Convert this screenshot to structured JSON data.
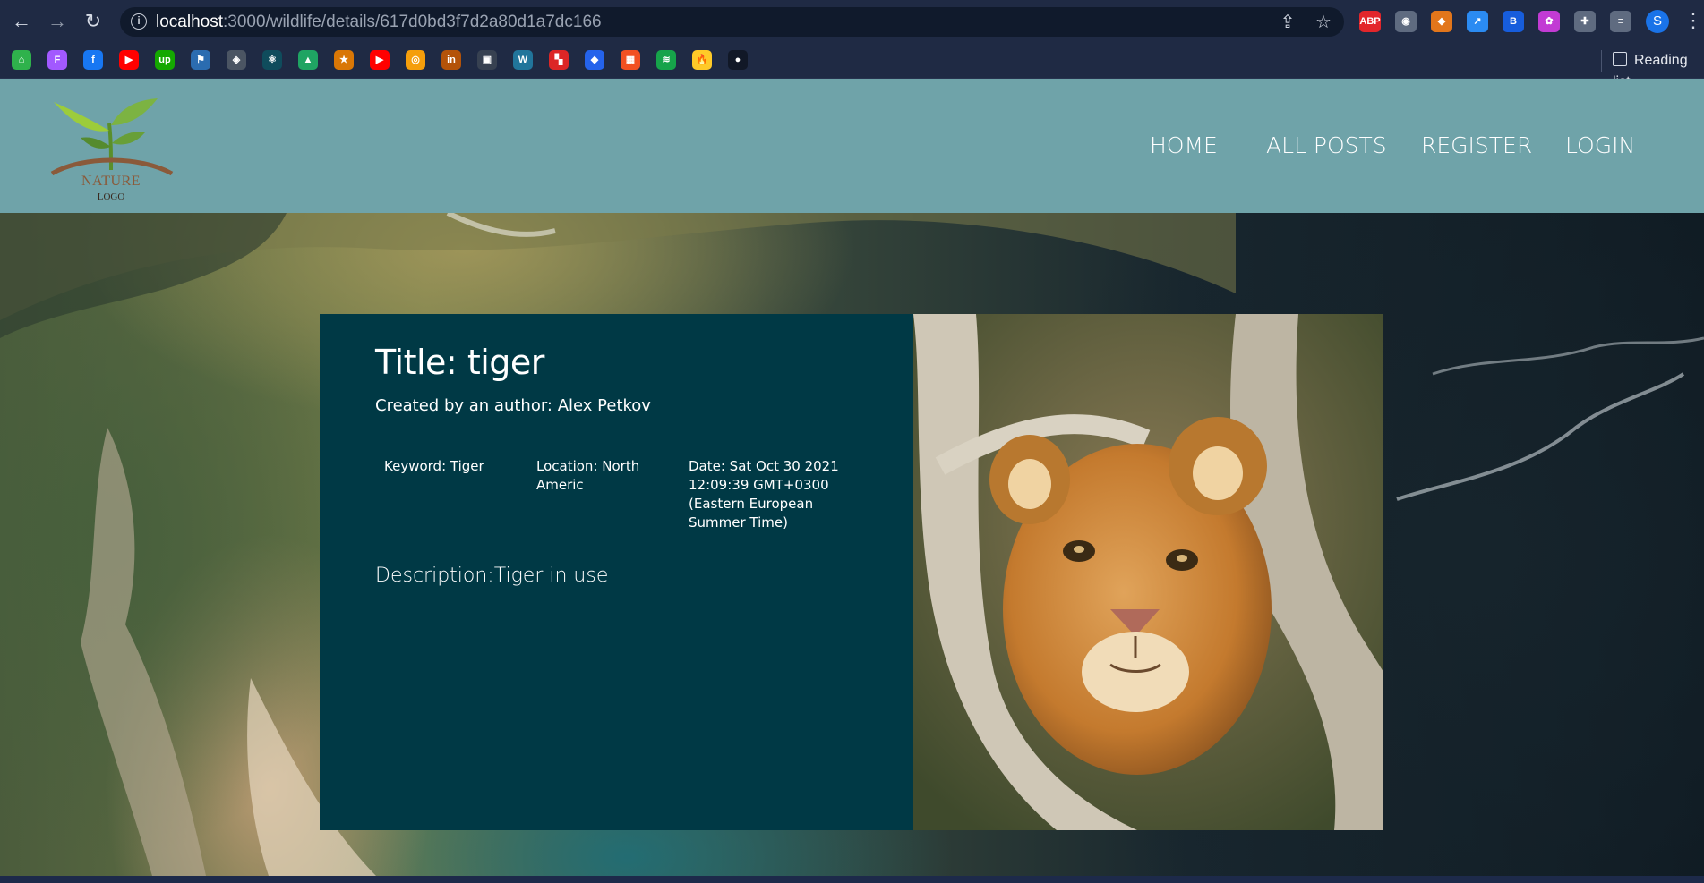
{
  "browser": {
    "url_host": "localhost",
    "url_path": ":3000/wildlife/details/617d0bd3f7d2a80d1a7dc166",
    "profile_initial": "S",
    "reading_list_label": "Reading list",
    "extensions": [
      {
        "icon": "adblock-plus-icon",
        "label": "ABP",
        "color": "#e3262b"
      },
      {
        "icon": "camera-icon",
        "label": "◉",
        "color": "#5f6b80"
      },
      {
        "icon": "metamask-icon",
        "label": "◆",
        "color": "#e2761b"
      },
      {
        "icon": "arrow-extension-icon",
        "label": "↗",
        "color": "#2b8bf2"
      },
      {
        "icon": "bitwarden-icon",
        "label": "B",
        "color": "#175ddc"
      },
      {
        "icon": "color-wheel-icon",
        "label": "✿",
        "color": "#c23bd4"
      },
      {
        "icon": "puzzle-icon",
        "label": "✚",
        "color": "#5f6b80"
      },
      {
        "icon": "media-queue-icon",
        "label": "≡",
        "color": "#5f6b80"
      }
    ],
    "bookmarks": [
      {
        "icon": "home-bookmark-icon",
        "label": "⌂",
        "color": "#2fb24c"
      },
      {
        "icon": "figma-icon",
        "label": "F",
        "color": "#a259ff"
      },
      {
        "icon": "facebook-icon",
        "label": "f",
        "color": "#1877f2"
      },
      {
        "icon": "youtube-icon",
        "label": "▶",
        "color": "#ff0000"
      },
      {
        "icon": "upwork-icon",
        "label": "up",
        "color": "#14a800"
      },
      {
        "icon": "flag-icon",
        "label": "⚑",
        "color": "#2b6cb0"
      },
      {
        "icon": "cube-icon",
        "label": "◈",
        "color": "#4b5563"
      },
      {
        "icon": "react-icon",
        "label": "⚛",
        "color": "#0f4c5c"
      },
      {
        "icon": "google-drive-icon",
        "label": "▲",
        "color": "#1fa463"
      },
      {
        "icon": "star-bookmark-icon",
        "label": "★",
        "color": "#d97706"
      },
      {
        "icon": "youtube-icon",
        "label": "▶",
        "color": "#ff0000"
      },
      {
        "icon": "box-icon",
        "label": "◎",
        "color": "#f59e0b"
      },
      {
        "icon": "invision-icon",
        "label": "in",
        "color": "#b45309"
      },
      {
        "icon": "image-icon",
        "label": "▣",
        "color": "#374151"
      },
      {
        "icon": "wordpress-icon",
        "label": "W",
        "color": "#21759b"
      },
      {
        "icon": "blocks-icon",
        "label": "▚",
        "color": "#dc2626"
      },
      {
        "icon": "diamond-icon",
        "label": "◆",
        "color": "#2563eb"
      },
      {
        "icon": "microsoft-icon",
        "label": "▦",
        "color": "#f25022"
      },
      {
        "icon": "layers-icon",
        "label": "≋",
        "color": "#16a34a"
      },
      {
        "icon": "firebase-icon",
        "label": "🔥",
        "color": "#ffca28"
      },
      {
        "icon": "github-icon",
        "label": "●",
        "color": "#111827"
      }
    ]
  },
  "site": {
    "logo_text": "NATURE",
    "logo_sub": "LOGO",
    "nav": [
      "HOME",
      "ALL POSTS",
      "REGISTER",
      "LOGIN"
    ]
  },
  "post": {
    "title": "Title: tiger",
    "author": "Created by an author: Alex Petkov",
    "keyword": "Keyword: Tiger",
    "location": "Location: North Americ",
    "date": "Date: Sat Oct 30 2021 12:09:39 GMT+0300 (Eastern European Summer Time)",
    "description": "Description:Tiger in use"
  },
  "colors": {
    "header_bg": "#6fa3a9",
    "card_bg": "#003945",
    "chrome_bg": "#1f2a44"
  }
}
